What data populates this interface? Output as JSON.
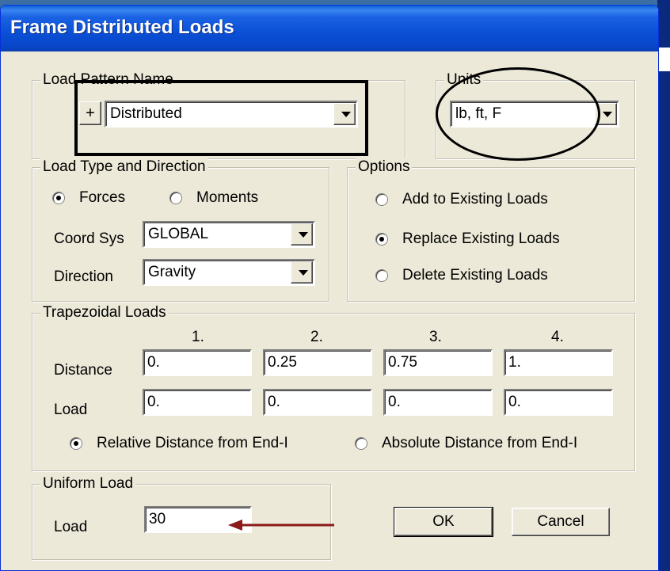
{
  "window": {
    "title": "Frame Distributed Loads"
  },
  "load_pattern": {
    "group_label": "Load Pattern Name",
    "add_label": "+",
    "value": "Distributed"
  },
  "units": {
    "group_label": "Units",
    "value": "lb, ft, F"
  },
  "load_type": {
    "group_label": "Load Type and Direction",
    "forces_label": "Forces",
    "moments_label": "Moments",
    "selected": "Forces",
    "coord_sys_label": "Coord Sys",
    "coord_sys_value": "GLOBAL",
    "direction_label": "Direction",
    "direction_value": "Gravity"
  },
  "options": {
    "group_label": "Options",
    "add_label": "Add to Existing Loads",
    "replace_label": "Replace Existing Loads",
    "delete_label": "Delete Existing Loads",
    "selected": "Replace Existing Loads"
  },
  "trapezoidal": {
    "group_label": "Trapezoidal Loads",
    "columns": [
      "1.",
      "2.",
      "3.",
      "4."
    ],
    "distance_label": "Distance",
    "load_label": "Load",
    "distances": [
      "0.",
      "0.25",
      "0.75",
      "1."
    ],
    "loads": [
      "0.",
      "0.",
      "0.",
      "0."
    ],
    "relative_label": "Relative Distance from End-I",
    "absolute_label": "Absolute Distance from End-I",
    "selected": "Relative Distance from End-I"
  },
  "uniform": {
    "group_label": "Uniform Load",
    "load_label": "Load",
    "load_value": "30"
  },
  "buttons": {
    "ok_label": "OK",
    "cancel_label": "Cancel"
  },
  "colors": {
    "titlebar": "#0a4fd6",
    "dialog_bg": "#ece9d8",
    "arrow": "#8b1a1a"
  }
}
